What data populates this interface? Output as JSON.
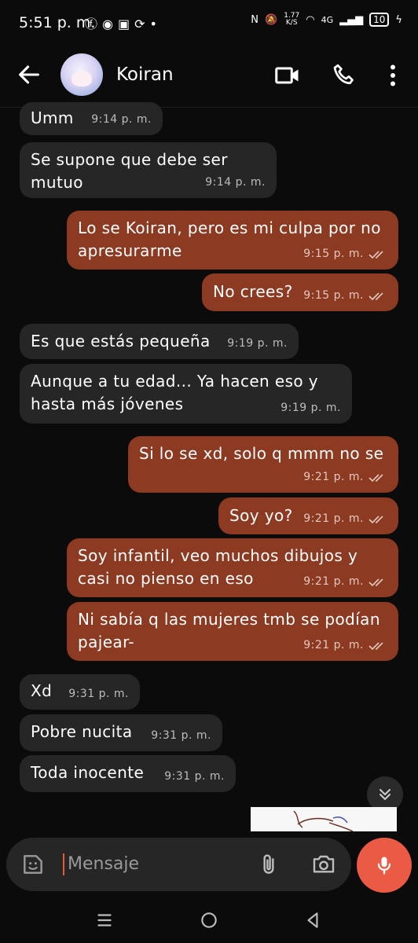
{
  "status": {
    "time": "5:51 p. m.",
    "left_icons": [
      "facebook-icon",
      "chat-bubble-icon",
      "app-icon",
      "rotate-icon",
      "dot-icon"
    ],
    "speed_top": "1.77",
    "speed_bottom": "K/S",
    "network": "4G",
    "battery": "10"
  },
  "header": {
    "contact_name": "Koiran",
    "icons": [
      "back-arrow-icon",
      "avatar",
      "video-call-icon",
      "phone-icon",
      "more-vert-icon"
    ]
  },
  "messages": [
    {
      "dir": "in",
      "text": "Umm",
      "time": "9:14 p. m."
    },
    {
      "dir": "in",
      "text": "Se supone que debe ser mutuo",
      "time": "9:14 p. m."
    },
    {
      "dir": "out",
      "text": "Lo se Koiran, pero es mi culpa por no apresurarme",
      "time": "9:15 p. m."
    },
    {
      "dir": "out",
      "text": "No crees?",
      "time": "9:15 p. m."
    },
    {
      "dir": "in",
      "text": "Es que estás pequeña",
      "time": "9:19 p. m."
    },
    {
      "dir": "in",
      "text": "Aunque a tu edad... Ya hacen eso y hasta más jóvenes",
      "time": "9:19 p. m."
    },
    {
      "dir": "out",
      "text": "Si lo se xd, solo q mmm no se",
      "time": "9:21 p. m."
    },
    {
      "dir": "out",
      "text": "Soy yo?",
      "time": "9:21 p. m."
    },
    {
      "dir": "out",
      "text": "Soy infantil, veo muchos dibujos y casi no pienso en eso",
      "time": "9:21 p. m."
    },
    {
      "dir": "out",
      "text": "Ni sabía q las mujeres tmb se podían pajear-",
      "time": "9:21 p. m."
    },
    {
      "dir": "in",
      "text": "Xd",
      "time": "9:31 p. m."
    },
    {
      "dir": "in",
      "text": "Pobre nucita",
      "time": "9:31 p. m."
    },
    {
      "dir": "in",
      "text": "Toda inocente",
      "time": "9:31 p. m."
    }
  ],
  "input": {
    "placeholder": "Mensaje"
  },
  "colors": {
    "incoming_bubble": "#262626",
    "outgoing_bubble": "#8c3a22",
    "mic_button": "#ea5a44",
    "background": "#0b0b0b"
  }
}
